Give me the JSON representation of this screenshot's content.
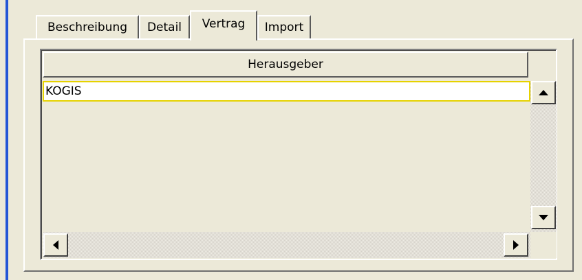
{
  "tabs": [
    {
      "label": "Beschreibung",
      "active": false
    },
    {
      "label": "Detail",
      "active": false
    },
    {
      "label": "Vertrag",
      "active": true
    },
    {
      "label": "Import",
      "active": false
    }
  ],
  "table": {
    "columns": [
      "Herausgeber"
    ],
    "rows": [
      [
        "KOGIS"
      ]
    ]
  },
  "icons": {
    "scroll_up": "triangle-up-icon",
    "scroll_down": "triangle-down-icon",
    "scroll_left": "triangle-left-icon",
    "scroll_right": "triangle-right-icon"
  },
  "colors": {
    "window_bg": "#ece9d8",
    "left_accent": "#2456d6",
    "selected_row_border": "#e6d200"
  }
}
